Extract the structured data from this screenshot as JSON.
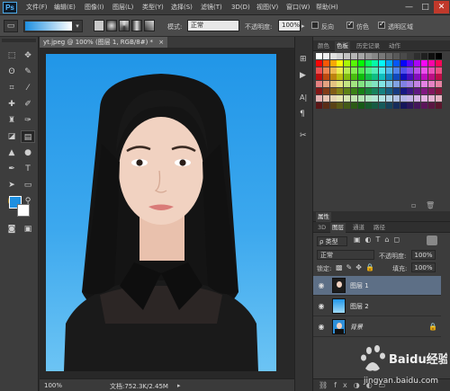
{
  "app": {
    "logo": "Ps"
  },
  "menu": [
    "文件(F)",
    "编辑(E)",
    "图像(I)",
    "图层(L)",
    "类型(Y)",
    "选择(S)",
    "滤镜(T)",
    "3D(D)",
    "视图(V)",
    "窗口(W)",
    "帮助(H)"
  ],
  "window_controls": {
    "minimize": "—",
    "restore": "□",
    "close": "✕"
  },
  "options": {
    "mode_label": "模式:",
    "mode_value": "正常",
    "opacity_label": "不透明度:",
    "opacity_value": "100%",
    "reverse_label": "反向",
    "dither_label": "仿色",
    "transparency_label": "透明区域",
    "reverse_checked": false,
    "dither_checked": true,
    "transparency_checked": true
  },
  "document": {
    "tab_title": "yt.jpeg @ 100% (图层 1, RGB/8#) *",
    "tab_close": "×",
    "zoom": "100%",
    "doc_info": "文档:752.3K/2.45M"
  },
  "colors": {
    "foreground": "#1e8fe0",
    "background": "#ffffff",
    "accent": "#5d6f86"
  },
  "swatches_panel": {
    "tabs": [
      "颜色",
      "色板",
      "历史记录",
      "动作"
    ],
    "active_tab": "色板"
  },
  "properties_panel": {
    "title": "属性"
  },
  "layers_panel": {
    "tabs": [
      "3D",
      "图层",
      "通道",
      "路径"
    ],
    "active_tab": "图层",
    "filter_kind": "ρ 类型",
    "blend_mode": "正常",
    "opacity_label": "不透明度:",
    "opacity_value": "100%",
    "lock_label": "锁定:",
    "fill_label": "填充:",
    "fill_value": "100%",
    "layers": [
      {
        "name": "图层 1",
        "selected": true,
        "visible": true
      },
      {
        "name": "图层 2",
        "selected": false,
        "visible": true
      },
      {
        "name": "背景",
        "selected": false,
        "visible": true,
        "locked": true
      }
    ]
  },
  "watermark": {
    "text": "Baidu经验",
    "url": "jingyan.baidu.com"
  }
}
